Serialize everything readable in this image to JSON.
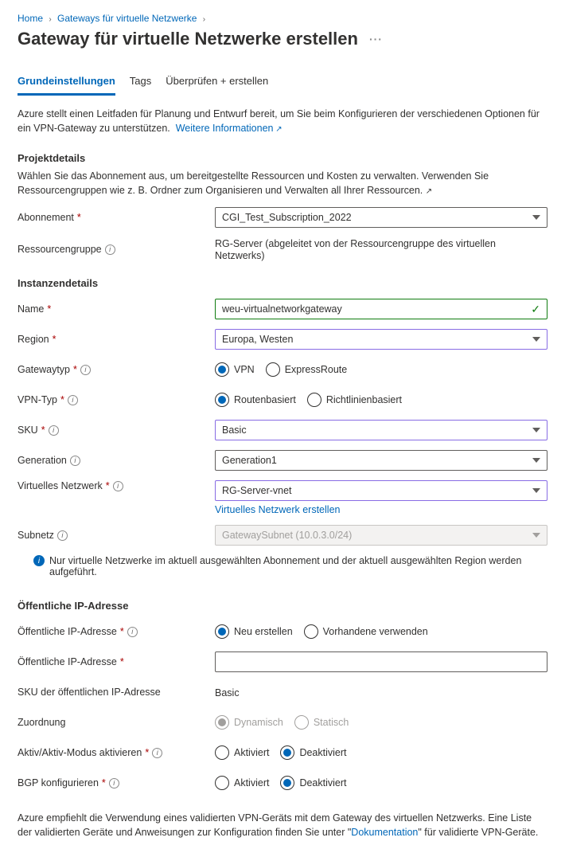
{
  "breadcrumb": {
    "home": "Home",
    "second": "Gateways für virtuelle Netzwerke"
  },
  "page_title": "Gateway für virtuelle Netzwerke erstellen",
  "tabs": {
    "t1": "Grundeinstellungen",
    "t2": "Tags",
    "t3": "Überprüfen + erstellen"
  },
  "intro": {
    "text": "Azure stellt einen Leitfaden für Planung und Entwurf bereit, um Sie beim Konfigurieren der verschiedenen Optionen für ein VPN-Gateway zu unterstützen.",
    "link": "Weitere Informationen"
  },
  "project": {
    "heading": "Projektdetails",
    "text": "Wählen Sie das Abonnement aus, um bereitgestellte Ressourcen und Kosten zu verwalten. Verwenden Sie Ressourcengruppen wie z. B. Ordner zum Organisieren und Verwalten all Ihrer Ressourcen.",
    "subscription_label": "Abonnement",
    "subscription_value": "CGI_Test_Subscription_2022",
    "rg_label": "Ressourcengruppe",
    "rg_value": "RG-Server (abgeleitet von der Ressourcengruppe des virtuellen Netzwerks)"
  },
  "instance": {
    "heading": "Instanzendetails",
    "name_label": "Name",
    "name_value": "weu-virtualnetworkgateway",
    "region_label": "Region",
    "region_value": "Europa, Westen",
    "gwtype_label": "Gatewaytyp",
    "gwtype_opt1": "VPN",
    "gwtype_opt2": "ExpressRoute",
    "vpntype_label": "VPN-Typ",
    "vpntype_opt1": "Routenbasiert",
    "vpntype_opt2": "Richtlinienbasiert",
    "sku_label": "SKU",
    "sku_value": "Basic",
    "gen_label": "Generation",
    "gen_value": "Generation1",
    "vnet_label": "Virtuelles Netzwerk",
    "vnet_value": "RG-Server-vnet",
    "vnet_create_link": "Virtuelles Netzwerk erstellen",
    "subnet_label": "Subnetz",
    "subnet_value": "GatewaySubnet (10.0.3.0/24)",
    "subnet_note": "Nur virtuelle Netzwerke im aktuell ausgewählten Abonnement und der aktuell ausgewählten Region werden aufgeführt."
  },
  "pubip": {
    "heading": "Öffentliche IP-Adresse",
    "mode_label": "Öffentliche IP-Adresse",
    "mode_opt1": "Neu erstellen",
    "mode_opt2": "Vorhandene verwenden",
    "name_label": "Öffentliche IP-Adresse",
    "sku_label": "SKU der öffentlichen IP-Adresse",
    "sku_value": "Basic",
    "assign_label": "Zuordnung",
    "assign_opt1": "Dynamisch",
    "assign_opt2": "Statisch",
    "activeactive_label": "Aktiv/Aktiv-Modus aktivieren",
    "aa_opt1": "Aktiviert",
    "aa_opt2": "Deaktiviert",
    "bgp_label": "BGP konfigurieren",
    "bgp_opt1": "Aktiviert",
    "bgp_opt2": "Deaktiviert"
  },
  "footer": {
    "p1": "Azure empfiehlt die Verwendung eines validierten VPN-Geräts mit dem Gateway des virtuellen Netzwerks. Eine Liste der validierten Geräte und Anweisungen zur Konfiguration finden Sie unter \"",
    "doclink": "Dokumentation",
    "p2": "\" für validierte VPN-Geräte."
  }
}
